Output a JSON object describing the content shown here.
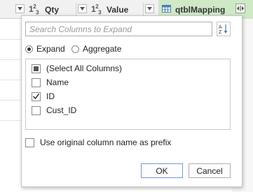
{
  "header": {
    "columns": [
      {
        "type_icon": "1²₃",
        "name": "Qty"
      },
      {
        "type_icon": "1²₃",
        "name": "Value"
      },
      {
        "type_icon": "table-icon",
        "name": "qtblMapping"
      }
    ],
    "expand_icon": "expand-arrows-icon"
  },
  "popup": {
    "search_placeholder": "Search Columns to Expand",
    "sort_icon": "sort-az-icon",
    "mode": {
      "expand_label": "Expand",
      "aggregate_label": "Aggregate",
      "selected": "Expand"
    },
    "columns_list": [
      {
        "label": "(Select All Columns)",
        "state": "partial"
      },
      {
        "label": "Name",
        "state": "unchecked"
      },
      {
        "label": "ID",
        "state": "checked"
      },
      {
        "label": "Cust_ID",
        "state": "unchecked"
      }
    ],
    "prefix_label": "Use original column name as prefix",
    "prefix_checked": false,
    "ok_label": "OK",
    "cancel_label": "Cancel"
  },
  "colors": {
    "mapping_header": "#cfe8c6",
    "ok_border": "#6e9bd1"
  }
}
